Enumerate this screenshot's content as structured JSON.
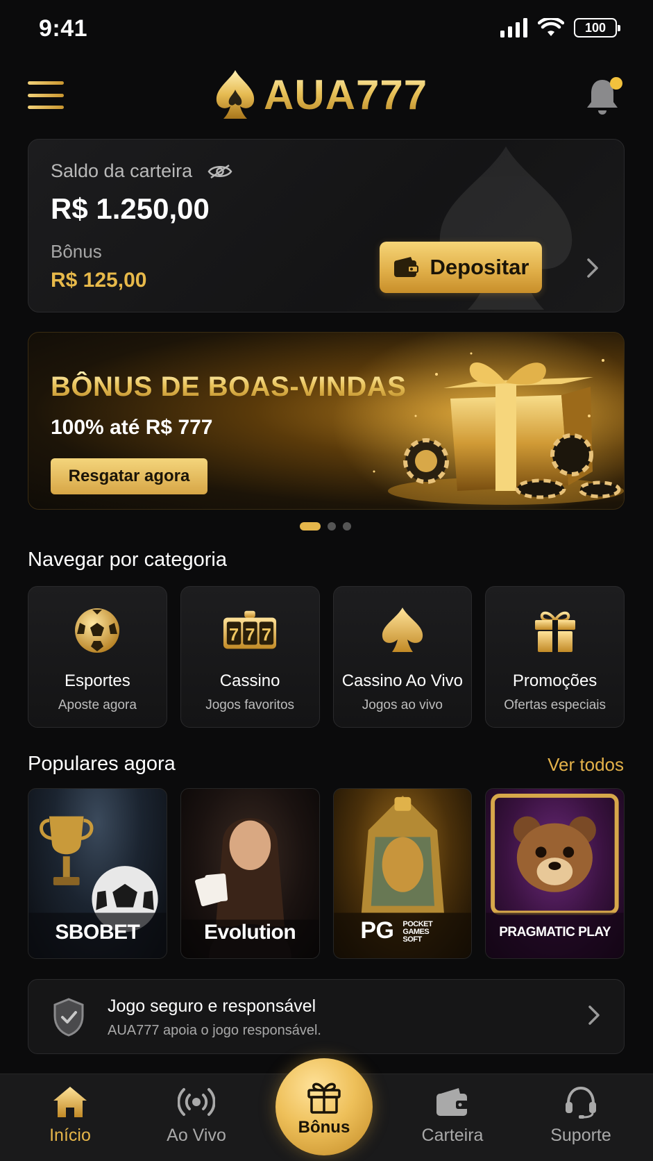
{
  "status_bar": {
    "time": "9:41",
    "battery": "100"
  },
  "header": {
    "logo_text": "AUA777"
  },
  "wallet": {
    "balance_label": "Saldo da carteira",
    "balance_amount": "R$ 1.250,00",
    "bonus_label": "Bônus",
    "bonus_amount": "R$ 125,00",
    "deposit_label": "Depositar"
  },
  "banner": {
    "title": "BÔNUS DE BOAS-VINDAS",
    "subtitle": "100% até R$ 777",
    "cta_label": "Resgatar agora",
    "active_slide": 1,
    "slide_count": 3
  },
  "categories": {
    "title": "Navegar por categoria",
    "items": [
      {
        "name": "Esportes",
        "sub": "Aposte agora",
        "icon": "soccer-ball-icon"
      },
      {
        "name": "Cassino",
        "sub": "Jogos favoritos",
        "icon": "slot-777-icon"
      },
      {
        "name": "Cassino Ao Vivo",
        "sub": "Jogos ao vivo",
        "icon": "spade-icon"
      },
      {
        "name": "Promoções",
        "sub": "Ofertas especiais",
        "icon": "gift-icon"
      }
    ]
  },
  "popular": {
    "title": "Populares agora",
    "see_all": "Ver todos",
    "providers": [
      "SBOBET",
      "Evolution",
      "PG",
      "PRAGMATIC PLAY"
    ],
    "pg_tagline": "POCKET GAMES SOFT"
  },
  "responsible": {
    "title": "Jogo seguro e responsável",
    "subtitle": "AUA777 apoia o jogo responsável."
  },
  "bottom_nav": {
    "items": [
      {
        "label": "Início",
        "icon": "home-icon"
      },
      {
        "label": "Ao Vivo",
        "icon": "live-broadcast-icon"
      },
      {
        "label": "Bônus",
        "icon": "gift-icon"
      },
      {
        "label": "Carteira",
        "icon": "wallet-icon"
      },
      {
        "label": "Suporte",
        "icon": "headset-icon"
      }
    ]
  },
  "colors": {
    "accent_gold": "#e6b64a",
    "background": "#0b0b0c",
    "card": "#161617"
  }
}
